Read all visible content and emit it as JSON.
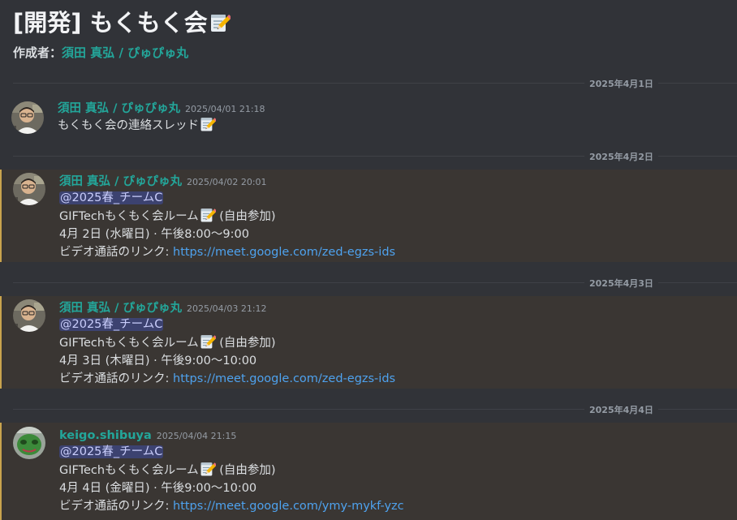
{
  "thread": {
    "title": "[開発] もくもく会",
    "author_prefix": "作成者：",
    "author_name": "須田 真弘 / ぴゅぴゅ丸"
  },
  "dividers": [
    "2025年4月1日",
    "2025年4月2日",
    "2025年4月3日",
    "2025年4月4日"
  ],
  "messages": [
    {
      "username": "須田 真弘 / ぴゅぴゅ丸",
      "timestamp": "2025/04/01 21:18",
      "text": "もくもく会の連絡スレッド"
    },
    {
      "username": "須田 真弘 / ぴゅぴゅ丸",
      "timestamp": "2025/04/02 20:01",
      "mention": "@2025春_チームC",
      "room": "GIFTechもくもく会ルーム",
      "room_suffix": " (自由参加)",
      "schedule": "4月 2日 (水曜日) · 午後8:00～9:00",
      "link_label": "ビデオ通話のリンク: ",
      "link_url": "https://meet.google.com/zed-egzs-ids"
    },
    {
      "username": "須田 真弘 / ぴゅぴゅ丸",
      "timestamp": "2025/04/03 21:12",
      "mention": "@2025春_チームC",
      "room": "GIFTechもくもく会ルーム",
      "room_suffix": " (自由参加)",
      "schedule": "4月 3日 (木曜日) · 午後9:00～10:00",
      "link_label": "ビデオ通話のリンク: ",
      "link_url": "https://meet.google.com/zed-egzs-ids"
    },
    {
      "username": "keigo.shibuya",
      "timestamp": "2025/04/04 21:15",
      "mention": "@2025春_チームC",
      "room": "GIFTechもくもく会ルーム",
      "room_suffix": " (自由参加)",
      "schedule": "4月 4日 (金曜日) · 午後9:00～10:00",
      "link_label": "ビデオ通話のリンク: ",
      "link_url": "https://meet.google.com/ymy-mykf-yzc"
    }
  ],
  "icons": {
    "memo": "memo-emoji",
    "avatar_1": "user-avatar",
    "avatar_2": "user-avatar"
  },
  "colors": {
    "background": "#313338",
    "highlight": "#3a3633",
    "highlight_bar": "#c9a44e",
    "username": "#23a69a",
    "link": "#4ea2ee",
    "mention_bg": "#3c4270"
  }
}
